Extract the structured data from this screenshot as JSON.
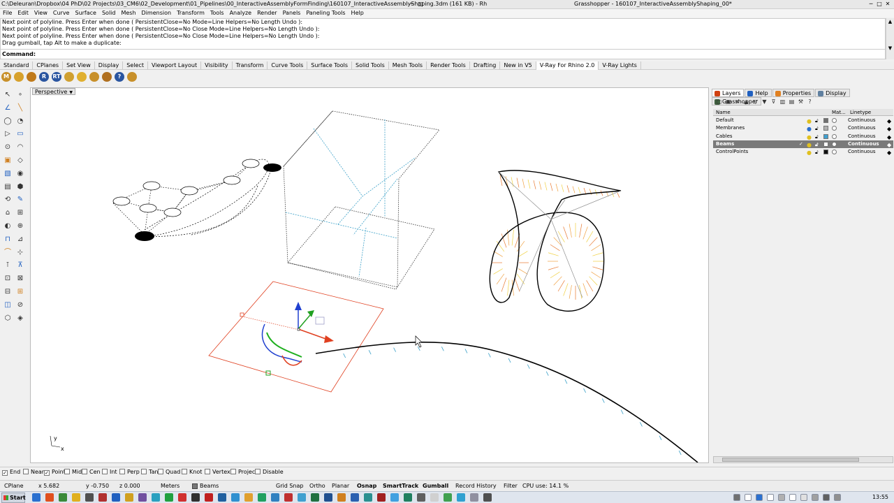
{
  "titlebar": {
    "title": "C:\\Deleuran\\Dropbox\\04 PhD\\02 Projects\\03_CM6\\02_Development\\01_Pipelines\\00_InteractiveAssemblyFormFinding\\160107_InteractiveAssemblyShaping.3dm (161 KB) - Rh",
    "gh_title": "Grasshopper - 160107_InteractiveAssemblyShaping_00*"
  },
  "menu": [
    "File",
    "Edit",
    "View",
    "Curve",
    "Surface",
    "Solid",
    "Mesh",
    "Dimension",
    "Transform",
    "Tools",
    "Analyze",
    "Render",
    "Panels",
    "Paneling Tools",
    "Help"
  ],
  "command_history": [
    "Next point of polyline. Press Enter when done ( PersistentClose=No  Mode=Line  Helpers=No  Length  Undo ):",
    "Next point of polyline. Press Enter when done ( PersistentClose=No  Close  Mode=Line  Helpers=No  Length  Undo ):",
    "Next point of polyline. Press Enter when done ( PersistentClose=No  Close  Mode=Line  Helpers=No  Length  Undo ):",
    "Drag gumball, tap Alt to make a duplicate:"
  ],
  "command_label": "Command:",
  "toolbar_tabs": [
    "Standard",
    "CPlanes",
    "Set View",
    "Display",
    "Select",
    "Viewport Layout",
    "Visibility",
    "Transform",
    "Curve Tools",
    "Surface Tools",
    "Solid Tools",
    "Mesh Tools",
    "Render Tools",
    "Drafting",
    "New in V5",
    "V-Ray For Rhino 2.0",
    "V-Ray Lights"
  ],
  "toolbar_icons": [
    {
      "label": "M",
      "color": "#c8902a"
    },
    {
      "label": "",
      "color": "#d7a12c"
    },
    {
      "label": "",
      "color": "#c07a1a"
    },
    {
      "label": "R",
      "color": "#2a55a0"
    },
    {
      "label": "RT",
      "color": "#2a55a0"
    },
    {
      "label": "",
      "color": "#d0a030"
    },
    {
      "label": "",
      "color": "#e0b030"
    },
    {
      "label": "",
      "color": "#c8902a"
    },
    {
      "label": "",
      "color": "#b07020"
    },
    {
      "label": "?",
      "color": "#2a55a0"
    },
    {
      "label": "",
      "color": "#c8902a"
    }
  ],
  "viewport": {
    "label": "Perspective",
    "axis_y": "y",
    "axis_x": "x"
  },
  "panel_tabs": [
    {
      "label": "Layers",
      "color": "#d04010",
      "active": true
    },
    {
      "label": "Help",
      "color": "#2060c0",
      "active": false
    },
    {
      "label": "Properties",
      "color": "#e08020",
      "active": false
    },
    {
      "label": "Display",
      "color": "#6080a0",
      "active": false
    },
    {
      "label": "Grasshopper",
      "color": "#406040",
      "active": false
    }
  ],
  "layer_columns": {
    "name": "Name",
    "material": "Mat...",
    "linetype": "Linetype"
  },
  "layers": [
    {
      "name": "Default",
      "color": "#707070",
      "linetype": "Continuous",
      "selected": false,
      "current": false
    },
    {
      "name": "Membranes",
      "color": "#b0b0b0",
      "linetype": "Continuous",
      "selected": false,
      "current": false
    },
    {
      "name": "Cables",
      "color": "#40a0d0",
      "linetype": "Continuous",
      "selected": false,
      "current": false
    },
    {
      "name": "Beams",
      "color": "#ffffff",
      "linetype": "Continuous",
      "selected": true,
      "current": true
    },
    {
      "name": "ControlPoints",
      "color": "#101010",
      "linetype": "Continuous",
      "selected": false,
      "current": false
    }
  ],
  "osnaps": [
    {
      "label": "End",
      "checked": true
    },
    {
      "label": "Near",
      "checked": false
    },
    {
      "label": "Point",
      "checked": true
    },
    {
      "label": "Mid",
      "checked": false
    },
    {
      "label": "Cen",
      "checked": false
    },
    {
      "label": "Int",
      "checked": false
    },
    {
      "label": "Perp",
      "checked": false
    },
    {
      "label": "Tan",
      "checked": false
    },
    {
      "label": "Quad",
      "checked": false
    },
    {
      "label": "Knot",
      "checked": false
    },
    {
      "label": "Vertex",
      "checked": false
    },
    {
      "label": "Project",
      "checked": false
    },
    {
      "label": "Disable",
      "checked": false
    }
  ],
  "status": {
    "cplane": "CPlane",
    "x": "x 5.682",
    "y": "y -0.750",
    "z": "z 0.000",
    "units": "Meters",
    "layer": "Beams",
    "grid_snap": "Grid Snap",
    "ortho": "Ortho",
    "planar": "Planar",
    "osnap": "Osnap",
    "smarttrack": "SmartTrack",
    "gumball": "Gumball",
    "record_history": "Record History",
    "filter": "Filter",
    "cpu": "CPU use: 14.1 %"
  },
  "taskbar": {
    "start": "Start",
    "clock": "13:55"
  },
  "colors": {
    "accent_red": "#e04020",
    "cable_blue": "#3aa0c8",
    "beam_black": "#000000"
  }
}
